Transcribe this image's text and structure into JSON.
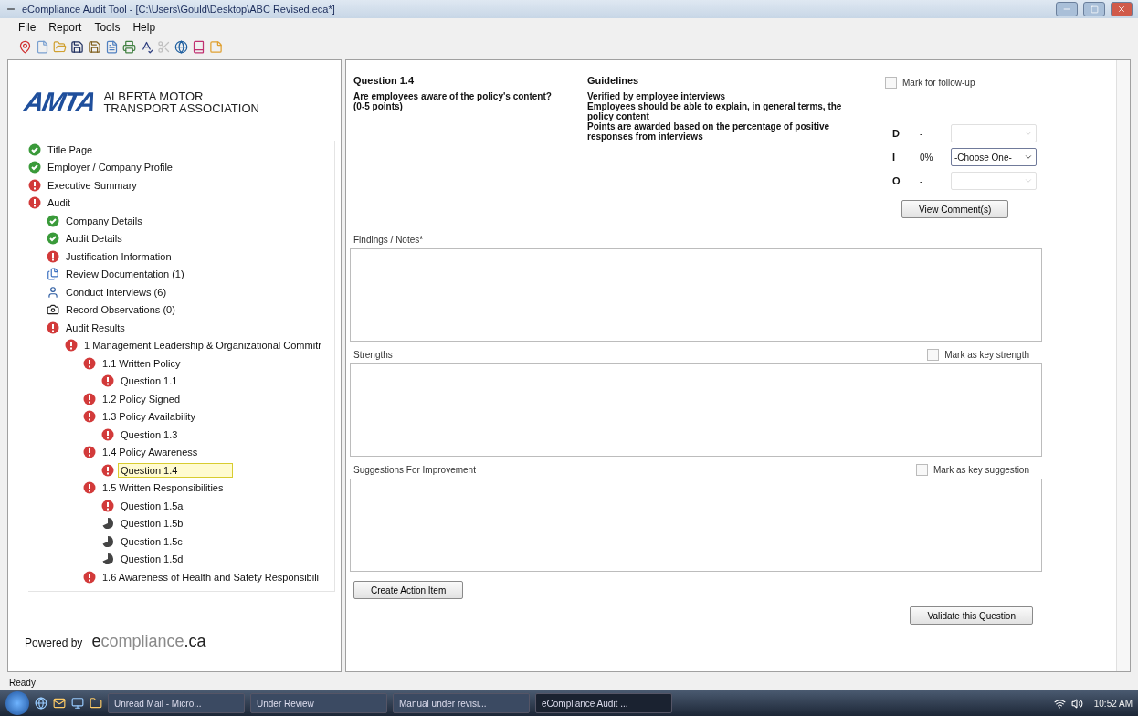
{
  "window": {
    "title": "eCompliance Audit Tool - [C:\\Users\\Gould\\Desktop\\ABC Revised.eca*]"
  },
  "menu": [
    "File",
    "Report",
    "Tools",
    "Help"
  ],
  "sidebar": {
    "logo": {
      "mark": "AMTA",
      "name_line_1": "ALBERTA MOTOR",
      "name_line_2": "TRANSPORT ASSOCIATION"
    },
    "tree": [
      {
        "label": "Title Page",
        "kind": "ok",
        "selected": false
      },
      {
        "label": "Employer / Company Profile",
        "kind": "ok",
        "selected": false
      },
      {
        "label": "Executive Summary",
        "kind": "error",
        "selected": false
      },
      {
        "label": "Audit",
        "kind": "error",
        "selected": false,
        "children": [
          {
            "label": "Company Details",
            "kind": "ok",
            "selected": false
          },
          {
            "label": "Audit Details",
            "kind": "ok",
            "selected": false
          },
          {
            "label": "Justification Information",
            "kind": "error",
            "selected": false
          },
          {
            "label": "Review Documentation (1)",
            "kind": "documents",
            "selected": false
          },
          {
            "label": "Conduct Interviews (6)",
            "kind": "interview",
            "selected": false
          },
          {
            "label": "Record Observations (0)",
            "kind": "observation",
            "selected": false
          },
          {
            "label": "Audit Results",
            "kind": "error",
            "selected": false,
            "children": [
              {
                "label": "1 Management Leadership & Organizational Commitr",
                "kind": "error",
                "selected": false,
                "children": [
                  {
                    "label": "1.1 Written Policy",
                    "kind": "error",
                    "selected": false,
                    "children": [
                      {
                        "label": "Question 1.1",
                        "kind": "error",
                        "selected": false
                      }
                    ]
                  },
                  {
                    "label": "1.2 Policy Signed",
                    "kind": "error",
                    "selected": false
                  },
                  {
                    "label": "1.3 Policy Availability",
                    "kind": "error",
                    "selected": false,
                    "children": [
                      {
                        "label": "Question 1.3",
                        "kind": "error",
                        "selected": false
                      }
                    ]
                  },
                  {
                    "label": "1.4 Policy Awareness",
                    "kind": "error",
                    "selected": false,
                    "children": [
                      {
                        "label": "Question 1.4",
                        "kind": "error",
                        "selected": true
                      }
                    ]
                  },
                  {
                    "label": "1.5 Written Responsibilities",
                    "kind": "error",
                    "selected": false,
                    "children": [
                      {
                        "label": "Question 1.5a",
                        "kind": "error",
                        "selected": false
                      },
                      {
                        "label": "Question 1.5b",
                        "kind": "pending",
                        "selected": false
                      },
                      {
                        "label": "Question 1.5c",
                        "kind": "pending",
                        "selected": false
                      },
                      {
                        "label": "Question 1.5d",
                        "kind": "pending",
                        "selected": false
                      }
                    ]
                  },
                  {
                    "label": "1.6 Awareness of Health and Safety Responsibili",
                    "kind": "error",
                    "selected": false
                  }
                ]
              }
            ]
          }
        ]
      }
    ],
    "powered_by": {
      "label": "Powered by",
      "logo_lead": "e",
      "logo_middle": "compliance",
      "logo_tail": ".ca"
    }
  },
  "question": {
    "heading": "Question 1.4",
    "text": "Are employees aware of the policy's content? (0-5 points)",
    "guidelines_heading": "Guidelines",
    "guidelines": [
      "Verified by employee interviews",
      "Employees should be able to explain, in general terms, the policy content",
      "Points are awarded based on the percentage of positive responses from interviews"
    ],
    "follow_up": {
      "label": "Mark for follow-up",
      "checked": false
    },
    "ratings": [
      {
        "letter": "D",
        "value": "-",
        "disabled": true
      },
      {
        "letter": "I",
        "value": "0%",
        "choice": "-Choose One-",
        "disabled": false
      },
      {
        "letter": "O",
        "value": "-",
        "disabled": true
      }
    ],
    "view_comments": "View Comment(s)",
    "sections": [
      {
        "label": "Findings / Notes*"
      },
      {
        "label": "Strengths",
        "mark": {
          "label": "Mark as key strength",
          "checked": false
        }
      },
      {
        "label": "Suggestions For Improvement",
        "mark": {
          "label": "Mark as key suggestion",
          "checked": false
        }
      }
    ],
    "create_action": "Create Action Item",
    "validate": "Validate this Question"
  },
  "status_bar": "Ready",
  "taskbar": {
    "items": [
      {
        "label": "Unread Mail - Micro...",
        "selected": false
      },
      {
        "label": "Under Review",
        "selected": false
      },
      {
        "label": "Manual under revisi...",
        "selected": false
      },
      {
        "label": "eCompliance Audit ...",
        "selected": true
      }
    ],
    "clock": "10:52 AM"
  }
}
